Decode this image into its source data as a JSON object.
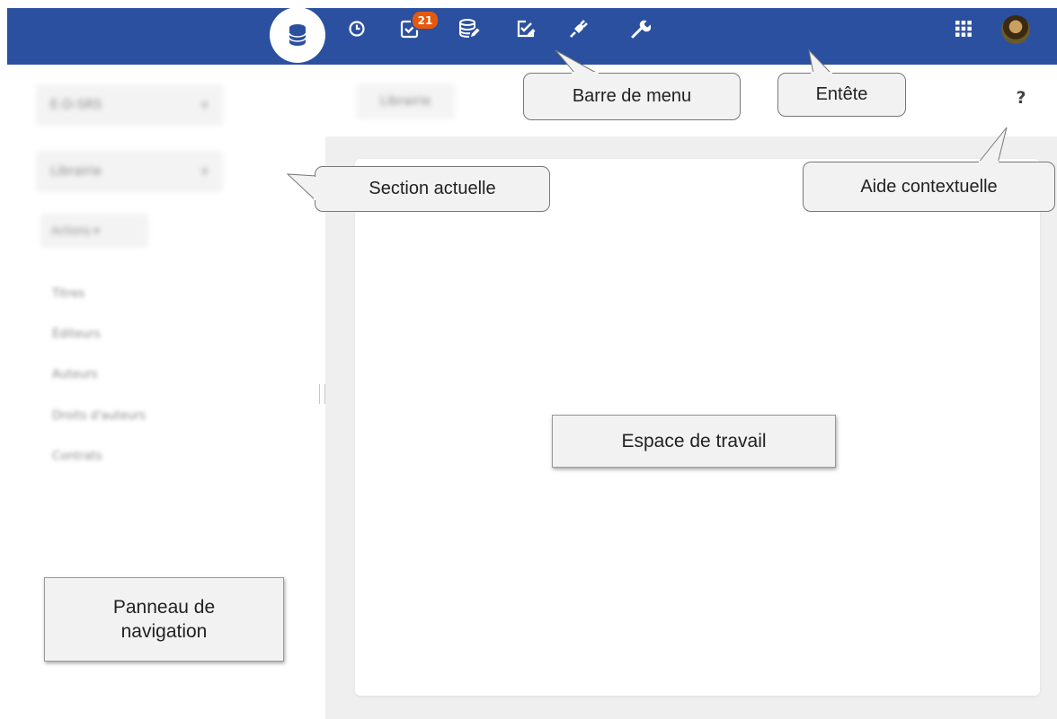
{
  "header": {
    "icons": [
      "database-icon",
      "history-icon",
      "tasks-icon",
      "data-edit-icon",
      "validation-icon",
      "plugin-icon",
      "tools-icon",
      "apps-grid-icon"
    ],
    "tasks_badge": "21",
    "colors": {
      "bar": "#2b50a0",
      "badge": "#e8580c"
    }
  },
  "nav": {
    "context": "E-D-SRS",
    "section": "Librairie",
    "actions": "Actions ▾",
    "links": [
      "Titres",
      "Éditeurs",
      "Auteurs",
      "Droits d'auteurs",
      "Contrats"
    ]
  },
  "breadcrumb": "Librairie",
  "help": "?",
  "callouts": {
    "menu_bar": "Barre de menu",
    "header": "Entête",
    "context_help": "Aide contextuelle",
    "current_section": "Section actuelle",
    "workspace": "Espace de travail",
    "nav_panel_line1": "Panneau de",
    "nav_panel_line2": "navigation"
  }
}
